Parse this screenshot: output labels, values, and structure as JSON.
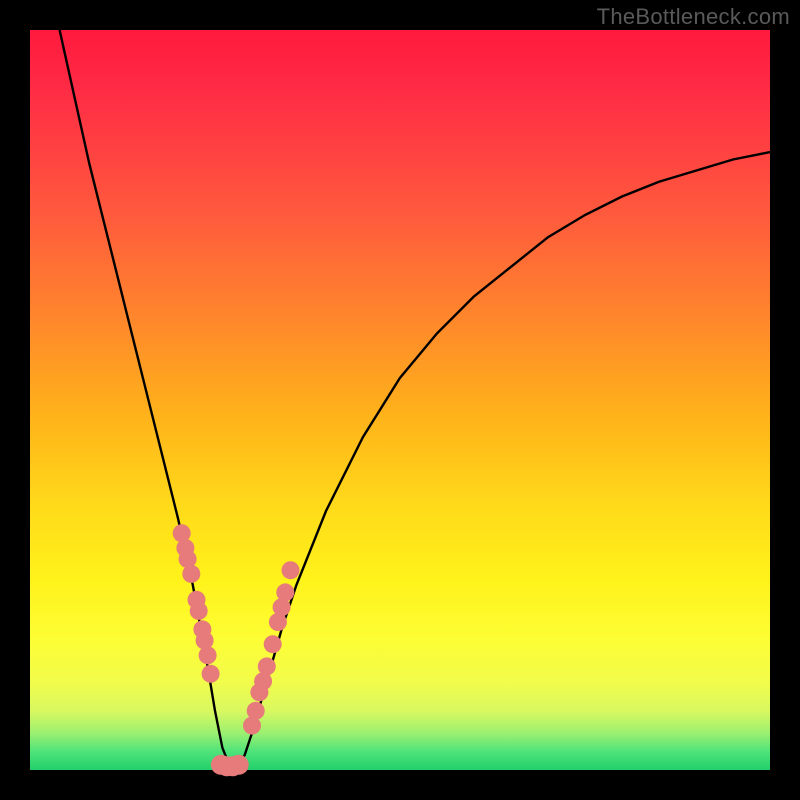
{
  "watermark": "TheBottleneck.com",
  "chart_data": {
    "type": "line",
    "title": "",
    "xlabel": "",
    "ylabel": "",
    "xlim": [
      0,
      100
    ],
    "ylim": [
      0,
      100
    ],
    "grid": false,
    "curve": {
      "comment": "V-shaped bottleneck curve; y is percent mismatch vs pairing x. Minimum ~0 near x≈27.",
      "x": [
        4,
        6,
        8,
        10,
        12,
        14,
        16,
        18,
        20,
        22,
        24,
        25,
        26,
        27,
        28,
        29,
        30,
        32,
        34,
        36,
        40,
        45,
        50,
        55,
        60,
        65,
        70,
        75,
        80,
        85,
        90,
        95,
        100
      ],
      "y": [
        100,
        91,
        82,
        74,
        66,
        58,
        50,
        42,
        34,
        25,
        14,
        8,
        3,
        0.5,
        0.5,
        2,
        5,
        12,
        19,
        25,
        35,
        45,
        53,
        59,
        64,
        68,
        72,
        75,
        77.5,
        79.5,
        81,
        82.5,
        83.5
      ]
    },
    "markers_left": {
      "comment": "Salmon markers on left branch (cluster)",
      "x": [
        20.5,
        21.0,
        21.3,
        21.8,
        22.5,
        22.8,
        23.3,
        23.6,
        24.0,
        24.4
      ],
      "y": [
        32,
        30,
        28.5,
        26.5,
        23,
        21.5,
        19,
        17.5,
        15.5,
        13
      ]
    },
    "markers_right": {
      "comment": "Salmon markers on right branch (cluster)",
      "x": [
        30.0,
        30.5,
        31.0,
        31.5,
        32.0,
        32.8,
        33.5,
        34.0,
        34.5,
        35.2
      ],
      "y": [
        6,
        8,
        10.5,
        12,
        14,
        17,
        20,
        22,
        24,
        27
      ]
    },
    "markers_bottom": {
      "comment": "Salmon rounded blob at the valley floor",
      "x": [
        25.8,
        26.6,
        27.4,
        28.2
      ],
      "y": [
        0.7,
        0.5,
        0.5,
        0.7
      ]
    },
    "marker_color": "#e77b7b",
    "curve_color": "#000000"
  }
}
